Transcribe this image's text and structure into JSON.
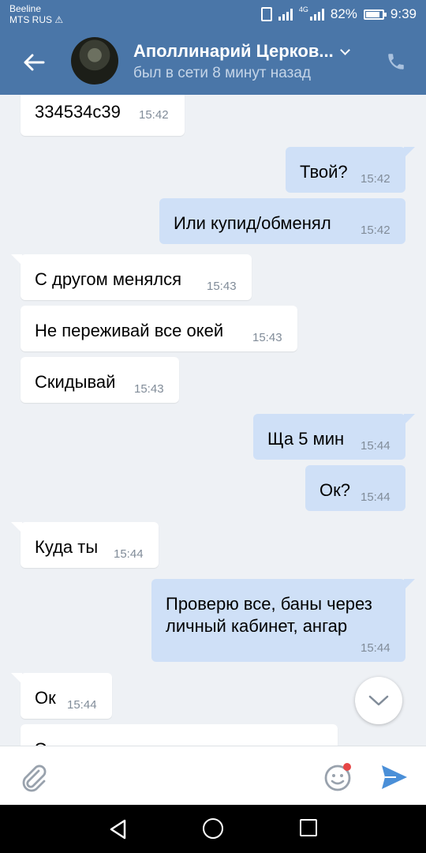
{
  "status_bar": {
    "carrier_1": "Beeline",
    "carrier_2": "MTS RUS",
    "warning": "⚠",
    "network": "4G",
    "battery": "82%",
    "time": "9:39"
  },
  "header": {
    "contact_name": "Аполлинарий Церков...",
    "last_seen": "был в сети 8 минут назад",
    "icons": [
      "back-arrow-icon",
      "chevron-down-icon",
      "phone-icon"
    ]
  },
  "messages": [
    {
      "dir": "in",
      "text": "334534c39",
      "time": "15:42"
    },
    {
      "dir": "out",
      "text": "Твой?",
      "time": "15:42"
    },
    {
      "dir": "out",
      "text": "Или купид/обменял",
      "time": "15:42"
    },
    {
      "dir": "in",
      "text": "С другом менялся",
      "time": "15:43"
    },
    {
      "dir": "in",
      "text": "Не переживай все окей",
      "time": "15:43"
    },
    {
      "dir": "in",
      "text": "Скидывай",
      "time": "15:43"
    },
    {
      "dir": "out",
      "text": "Ща 5 мин",
      "time": "15:44"
    },
    {
      "dir": "out",
      "text": "Ок?",
      "time": "15:44"
    },
    {
      "dir": "in",
      "text": "Куда ты",
      "time": "15:44"
    },
    {
      "dir": "out",
      "text": "Проверю все, баны через",
      "text2": "личный кабинет, ангар",
      "time": "15:44"
    },
    {
      "dir": "in",
      "text": "Ок",
      "time": "15:44"
    },
    {
      "dir": "in",
      "text": "Эт от почты",
      "time": ""
    }
  ],
  "colors": {
    "header_bg": "#4a76a8",
    "chat_bg": "#eef1f5",
    "incoming_bubble": "#ffffff",
    "outgoing_bubble": "#cfe0f7",
    "send_accent": "#4a8fd8",
    "notification_dot": "#e64646"
  },
  "input_bar": {
    "icons": [
      "attach-icon",
      "sticker-icon",
      "send-icon"
    ]
  },
  "nav_bar": {
    "icons": [
      "nav-back-icon",
      "nav-home-icon",
      "nav-recents-icon"
    ]
  }
}
